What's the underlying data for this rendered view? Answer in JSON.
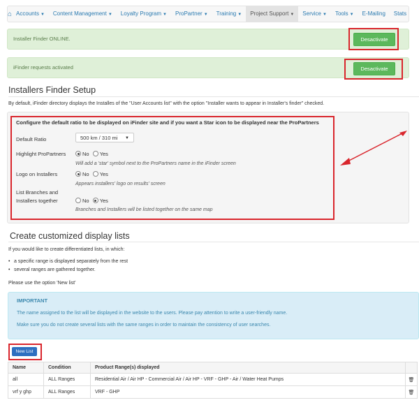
{
  "nav": {
    "items": [
      {
        "label": "Accounts",
        "caret": true
      },
      {
        "label": "Content Management",
        "caret": true
      },
      {
        "label": "Loyalty Program",
        "caret": true
      },
      {
        "label": "ProPartner",
        "caret": true
      },
      {
        "label": "Training",
        "caret": true
      },
      {
        "label": "Project Support",
        "caret": true,
        "active": true
      },
      {
        "label": "Service",
        "caret": true
      },
      {
        "label": "Tools",
        "caret": true
      },
      {
        "label": "E-Mailing",
        "caret": false
      },
      {
        "label": "Stats",
        "caret": false
      }
    ]
  },
  "alerts": [
    {
      "text": "Installer Finder ONLINE.",
      "button": "Desactivate"
    },
    {
      "text": "iFinder requests activated",
      "button": "Desactivate"
    }
  ],
  "setup": {
    "title": "Installers Finder Setup",
    "description": "By default, iFinder directory displays the Installes of the \"User Accounts list\" with the option \"Installer wants to appear in Installer's finder\" checked.",
    "panel_heading": "Configure the default ratio to be displayed on iFinder site and if you want a Star icon to be displayed near the ProPartners",
    "default_ratio": {
      "label": "Default Ratio",
      "value": "500 km / 310 mi"
    },
    "highlight": {
      "label": "Highlight ProPartners",
      "no": "No",
      "yes": "Yes",
      "selected": "No",
      "hint": "Will add a 'star' symbol next to the ProPartners name in the iFinder screen"
    },
    "logo": {
      "label": "Logo on Installers",
      "no": "No",
      "yes": "Yes",
      "selected": "No",
      "hint": "Appears installers' logo on results' screen"
    },
    "branches": {
      "label_line1": "List Branches and",
      "label_line2": "Installers together",
      "no": "No",
      "yes": "Yes",
      "selected": "Yes",
      "hint": "Branches and Installers will be listed together on the same map"
    }
  },
  "lists": {
    "title": "Create customized display lists",
    "intro": "If you would like to create differentiated lists, in which:",
    "bullets": [
      "a specific range is displayed separately from the rest",
      "several ranges are gathered together."
    ],
    "option_note": "Please use the option 'New list'",
    "important": {
      "heading": "IMPORTANT",
      "line1": "The name assigned to the list will be displayed in the website to the users. Please pay attention to write a user-friendly name.",
      "line2": "Make sure you do not create several lists with the same ranges in order to maintain the consistency of user searches."
    },
    "new_button": "New List",
    "table": {
      "headers": [
        "Name",
        "Condition",
        "Product Range(s) displayed"
      ],
      "rows": [
        [
          "all",
          "ALL Ranges",
          "Residential Air / Air HP - Commercial Air / Air HP - VRF - GHP - Air / Water Heat Pumps"
        ],
        [
          "vrf y ghp",
          "ALL Ranges",
          "VRF - GHP"
        ]
      ]
    }
  },
  "colors": {
    "accent_red": "#d9252c",
    "success": "#5cb85c",
    "primary": "#2d6fc0"
  }
}
